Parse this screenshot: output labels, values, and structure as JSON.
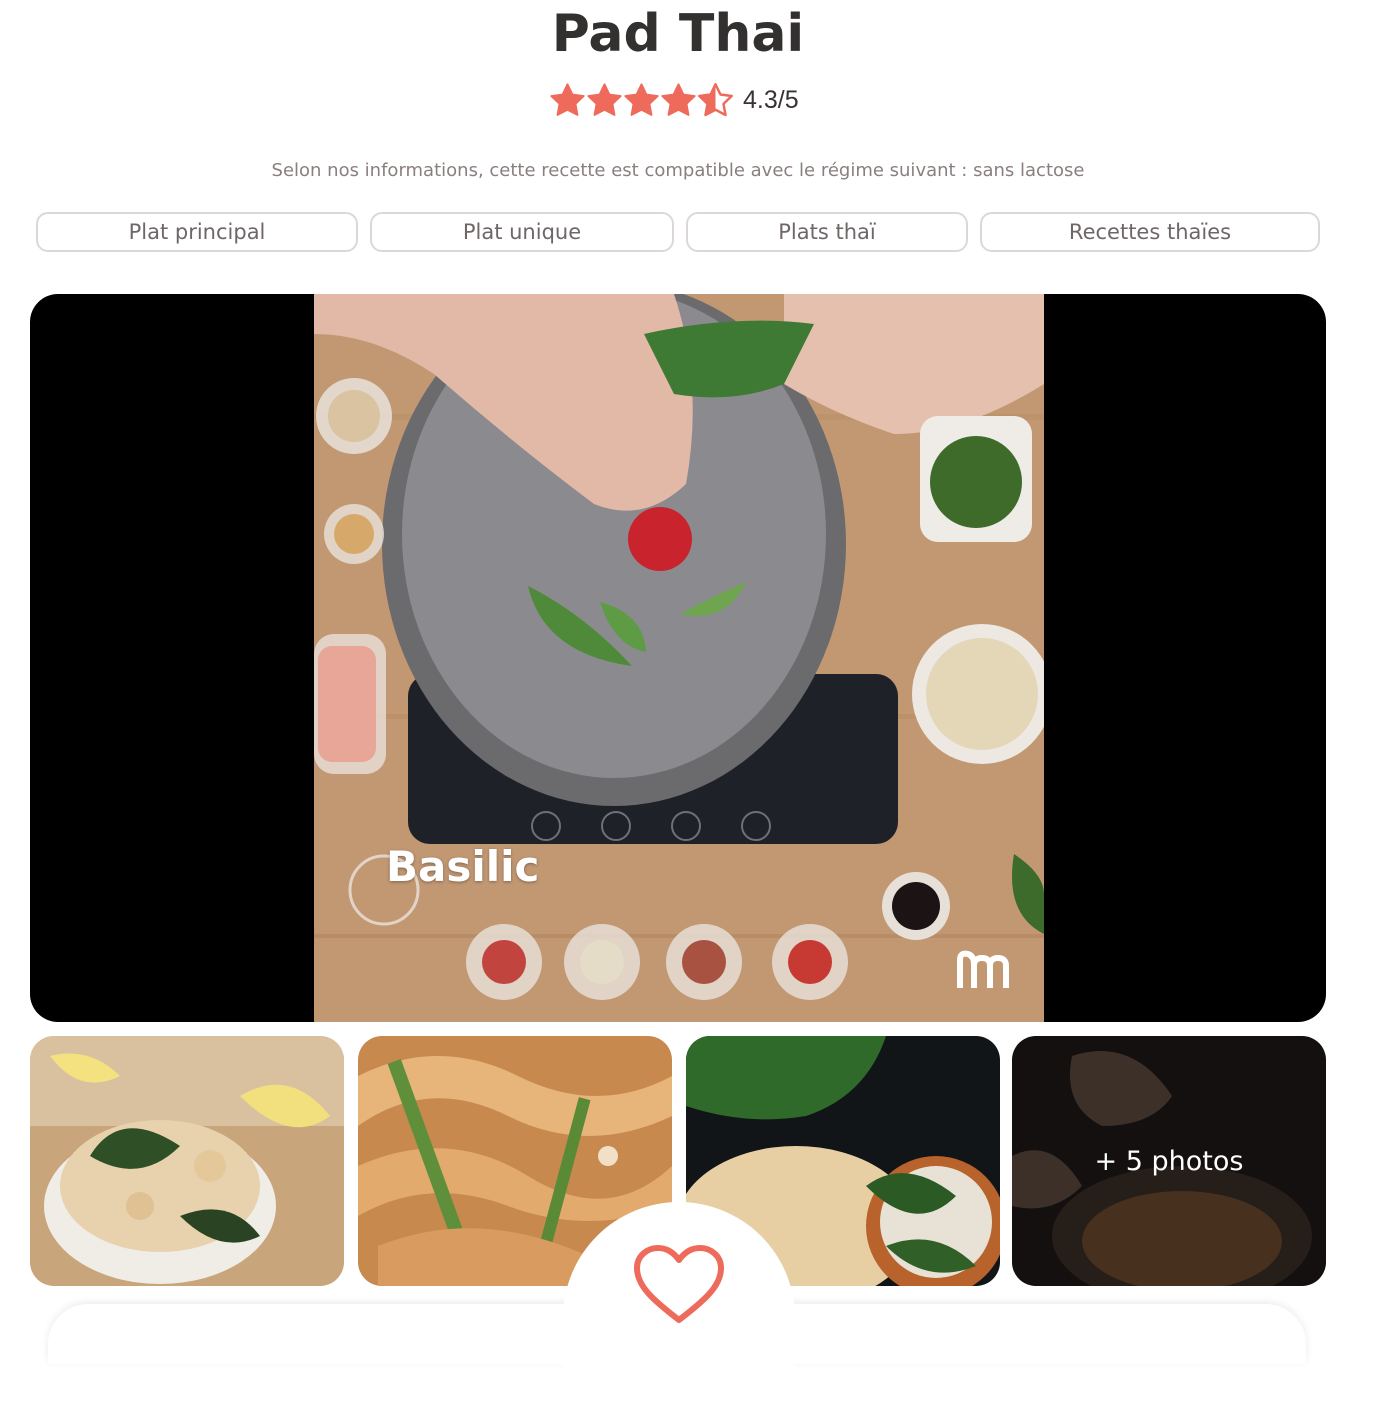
{
  "recipe": {
    "title": "Pad Thai",
    "rating": {
      "score": 4.3,
      "label": "4.3/5",
      "max_stars": 5,
      "star_color": "#ee6b5c"
    },
    "diet_note": "Selon nos informations, cette recette est compatible avec le régime suivant : sans lactose",
    "tags": [
      "Plat principal",
      "Plat unique",
      "Plats thaï",
      "Recettes thaïes"
    ]
  },
  "video": {
    "caption": "Basilic",
    "watermark_icon": "m-logo-icon"
  },
  "gallery": {
    "more_label": "+ 5 photos"
  },
  "favorite": {
    "icon": "heart-icon",
    "color": "#ee6b5c"
  }
}
